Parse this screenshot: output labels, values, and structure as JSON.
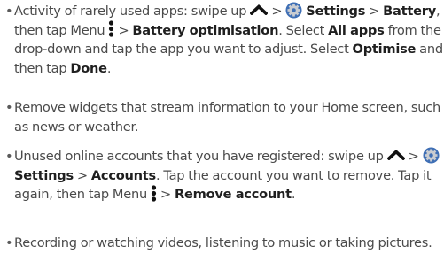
{
  "bullet_symbol": "•",
  "items": [
    {
      "parts": [
        "Activity of rarely used apps: swipe up",
        ">",
        "Settings",
        ">",
        "Battery",
        ", then tap Menu",
        ">",
        "Battery optimisation",
        ". Select",
        "All apps",
        "from the drop-down and tap the app you want to adjust. Select",
        "Optimise",
        "and then tap",
        "Done",
        "."
      ]
    },
    {
      "parts": [
        "Remove widgets that stream information to your Home screen, such as news or weather."
      ]
    },
    {
      "parts": [
        "Unused online accounts that you have registered: swipe up",
        ">",
        "Settings",
        ">",
        "Accounts",
        ". Tap the account you want to remove. Tap it again, then tap Menu",
        ">",
        "Remove account",
        "."
      ]
    },
    {
      "parts": [
        "Recording or watching videos, listening to music or taking pictures."
      ]
    }
  ],
  "icons": {
    "swipe_up": "chevron-up-icon",
    "settings": "settings-gear-icon",
    "menu": "vertical-dots-menu-icon"
  },
  "colors": {
    "text": "#4a4a4a",
    "bold_text": "#1f1f1f",
    "settings_icon_blue": "#3f6fb5",
    "settings_icon_gray": "#c9ccd1"
  }
}
